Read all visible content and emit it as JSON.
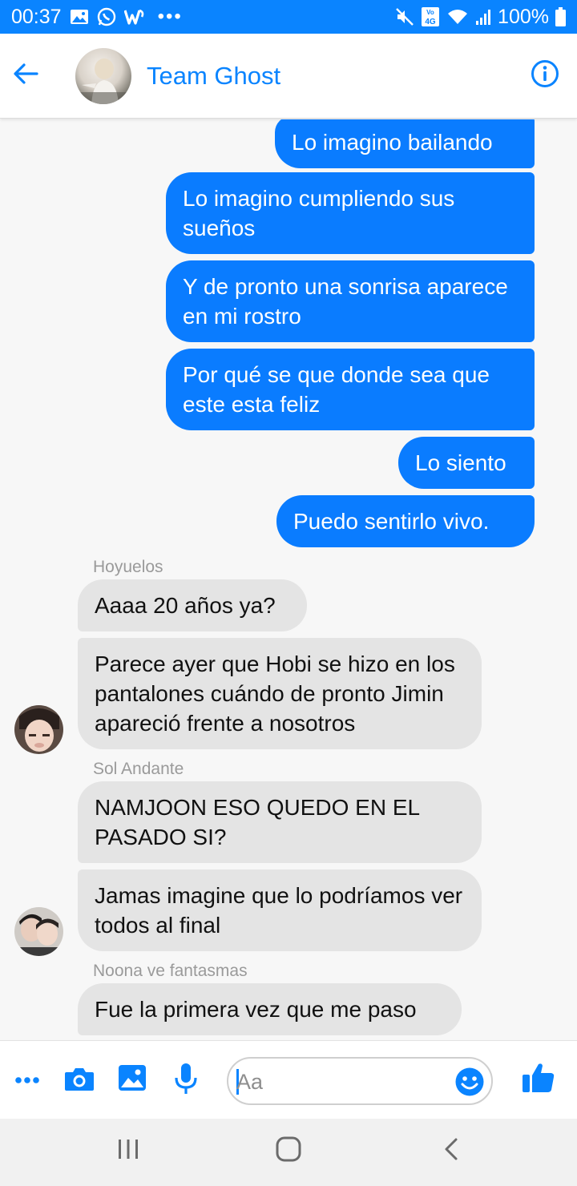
{
  "status_bar": {
    "time": "00:37",
    "battery": "100%",
    "network": "4G"
  },
  "header": {
    "title": "Team Ghost"
  },
  "messages": {
    "out": [
      "Lo imagino bailando",
      "Lo imagino cumpliendo sus sueños",
      "Y de pronto una sonrisa aparece en mi rostro",
      "Por qué se que donde sea que este esta feliz",
      "Lo siento",
      "Puedo sentirlo vivo."
    ],
    "senders": [
      "Hoyuelos",
      "Sol Andante",
      "Noona ve fantasmas"
    ],
    "in": [
      "Aaaa 20 años ya?",
      "Parece ayer que Hobi se hizo en los pantalones cuándo de pronto Jimin apareció frente a nosotros",
      "NAMJOON ESO QUEDO EN EL PASADO SI?",
      "Jamas imagine que lo podríamos ver todos al final",
      "Fue la primera vez que me paso"
    ]
  },
  "composer": {
    "placeholder": "Aa"
  },
  "colors": {
    "accent": "#0a84ff",
    "outgoing_bubble": "#0a7cff",
    "incoming_bubble": "#e4e4e4"
  },
  "icons": [
    "back-arrow",
    "info",
    "more",
    "camera",
    "image",
    "microphone",
    "emoji",
    "thumbs-up",
    "recents",
    "home",
    "back"
  ]
}
